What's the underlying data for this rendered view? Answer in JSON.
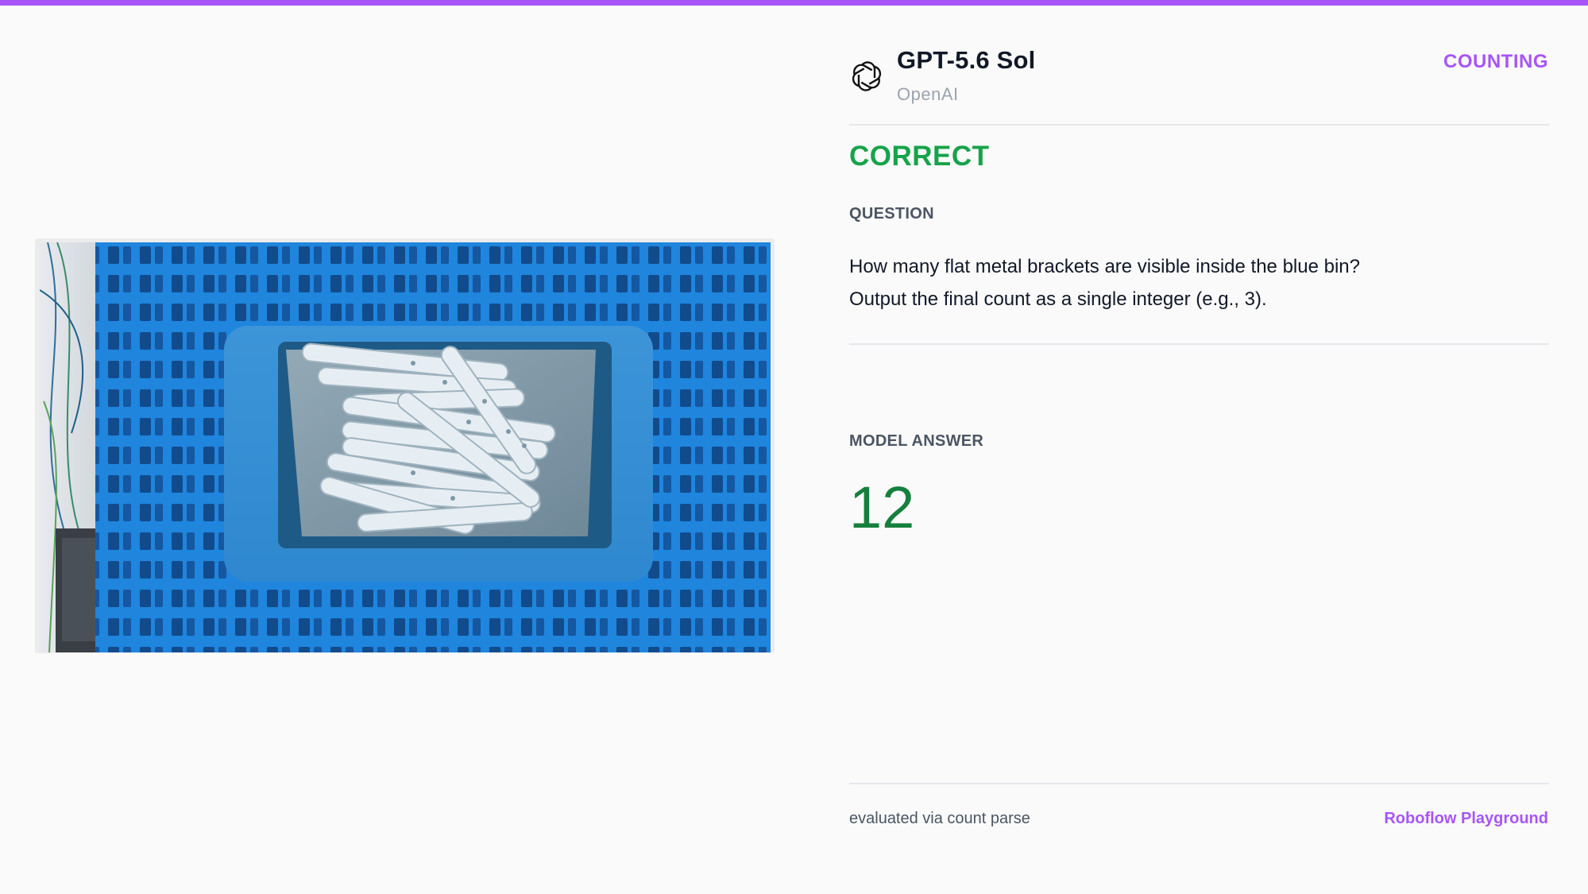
{
  "header": {
    "model_name": "GPT-5.6 Sol",
    "model_org": "OpenAI",
    "category": "COUNTING",
    "logo_icon": "openai-logo-icon"
  },
  "result": {
    "verdict": "CORRECT",
    "verdict_color": "#16a34a"
  },
  "question": {
    "label": "QUESTION",
    "lines": [
      "How many flat metal brackets are visible inside the blue bin?",
      "Output the final count as a single integer (e.g., 3)."
    ]
  },
  "answer": {
    "label": "MODEL ANSWER",
    "value": "12"
  },
  "footer": {
    "method": "evaluated via count parse",
    "brand": "Roboflow Playground"
  },
  "colors": {
    "accent": "#a855f7",
    "correct": "#16a34a",
    "answer": "#15803d"
  }
}
